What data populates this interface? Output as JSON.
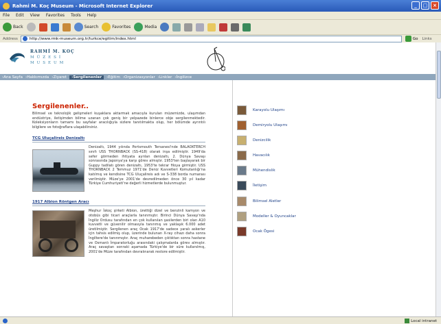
{
  "browser": {
    "title": "Rahmi M. Koç Museum - Microsoft Internet Explorer",
    "menu": [
      "File",
      "Edit",
      "View",
      "Favorites",
      "Tools",
      "Help"
    ],
    "toolbar": {
      "back": "Back",
      "search": "Search",
      "favorites": "Favorites",
      "media": "Media"
    },
    "address_label": "Address",
    "address_value": "http://www.rmk-museum.org.tr/turkce/egitim/index.html",
    "go_label": "Go",
    "links_label": "Links",
    "status_zone": "Local intranet"
  },
  "site": {
    "logo": {
      "line1": "RAHMİ M. KOÇ",
      "line2": "MÜZESİ",
      "line3": "MUSEUM"
    },
    "nav": [
      {
        "label": "›Ana Sayfa",
        "active": false
      },
      {
        "label": "›Hakkımızda",
        "active": false
      },
      {
        "label": "›Ziyaret",
        "active": false
      },
      {
        "label": "›Sergilenenler",
        "active": true
      },
      {
        "label": "›Eğitim",
        "active": false
      },
      {
        "label": "›Organizasyonlar",
        "active": false
      },
      {
        "label": "›Linkler",
        "active": false
      },
      {
        "label": "›İngilizce",
        "active": false
      }
    ]
  },
  "content": {
    "heading": "Sergilenenler..",
    "intro": "Bilimsel ve teknolojik gelişmeleri kuşaklara aktarmak amacıyla kurulan müzemizde, ulaşımdan endüstriye, iletişimden bilime uzanan çok geniş bir yelpazede binlerce obje sergilenmektedir. Koleksiyonların tamamı bu sayfalar aracılığıyla sizlere tanıtılmakta olup, her bölümde ayrıntılı bilgilere ve fotoğraflara ulaşabilirsiniz.",
    "items": [
      {
        "title": "TCG Uluçalireis Denizaltı",
        "text": "Denizaltı, 1944 yılında Portsmouth Tersanesi'nde BALAOKTERCH sınıfı USS THORNBACK (SS-418) olarak inşa edilmiştir. 1949'da sefer görmeden ihtiyata ayrılan denizaltı, 2. Dünya Savaşı sonrasında Japonya'ya karşı görev almıştır. 1953'ten başlayarak bir Guppy tadilatı gören denizaltı, 1953'te tekrar filoya girmiştir. USS THORNBACK 2 Temmuz 1971'de Deniz Kuvvetleri Komutanlığı'na katılmış ve kendisine TCG Uluçalireis adı ve S-338 borda numarası verilmiştir. Müze'ye 2001'de devredilmeden önce 30 yıl kadar Türkiye Cumhuriyeti'ne değerli hizmetlerde bulunmuştur."
      },
      {
        "title": "1917 Albion Röntgen Aracı",
        "text": "Meşhur İskoç şirketi Albion, ürettiği dizel ve benzinli kamyon ve otobüs gibi ticari araçlarla tanınmıştır. Birinci Dünya Savaşı'nda İngiliz Ordusu tarafından en çok kullanılan şasilerden biri olan A10 kuvvetli ve güvenilir olmasıyla tanınmış ve yaklaşık 6.000 adet üretilmiştir. Sergilenen araç Ocak 1917'de sadece yaralı askerler için tahsis edilmiş olup, üzerinde bulunan X-ray cihazı daha sonra İngiltere'de tanınmıştır. Araç muharebeden çıktıktan sonra hastane ve Osmanlı İmparatorluğu arasındaki çalışmalarda görev almıştır. Araç savaştan sonraki aşamada Türkiye'de bir süre kullanılmış, 2001'de Müze tarafından devralınarak restore edilmiştir."
      }
    ]
  },
  "sidebar": [
    {
      "label": "Karayolu Ulaşımı",
      "color": "#7a5a3a"
    },
    {
      "label": "Demiryolu Ulaşımı",
      "color": "#a06030"
    },
    {
      "label": "Denizcilik",
      "color": "#c8b070"
    },
    {
      "label": "Havacılık",
      "color": "#8a6a4a"
    },
    {
      "label": "Mühendislik",
      "color": "#6a7a8a"
    },
    {
      "label": "İletişim",
      "color": "#3a4a5a"
    },
    {
      "label": "Bilimsel Aletler",
      "color": "#a88a6a"
    },
    {
      "label": "Modeller & Oyuncaklar",
      "color": "#b0a080"
    },
    {
      "label": "Ocak Ögesi",
      "color": "#7a3a2a"
    }
  ]
}
